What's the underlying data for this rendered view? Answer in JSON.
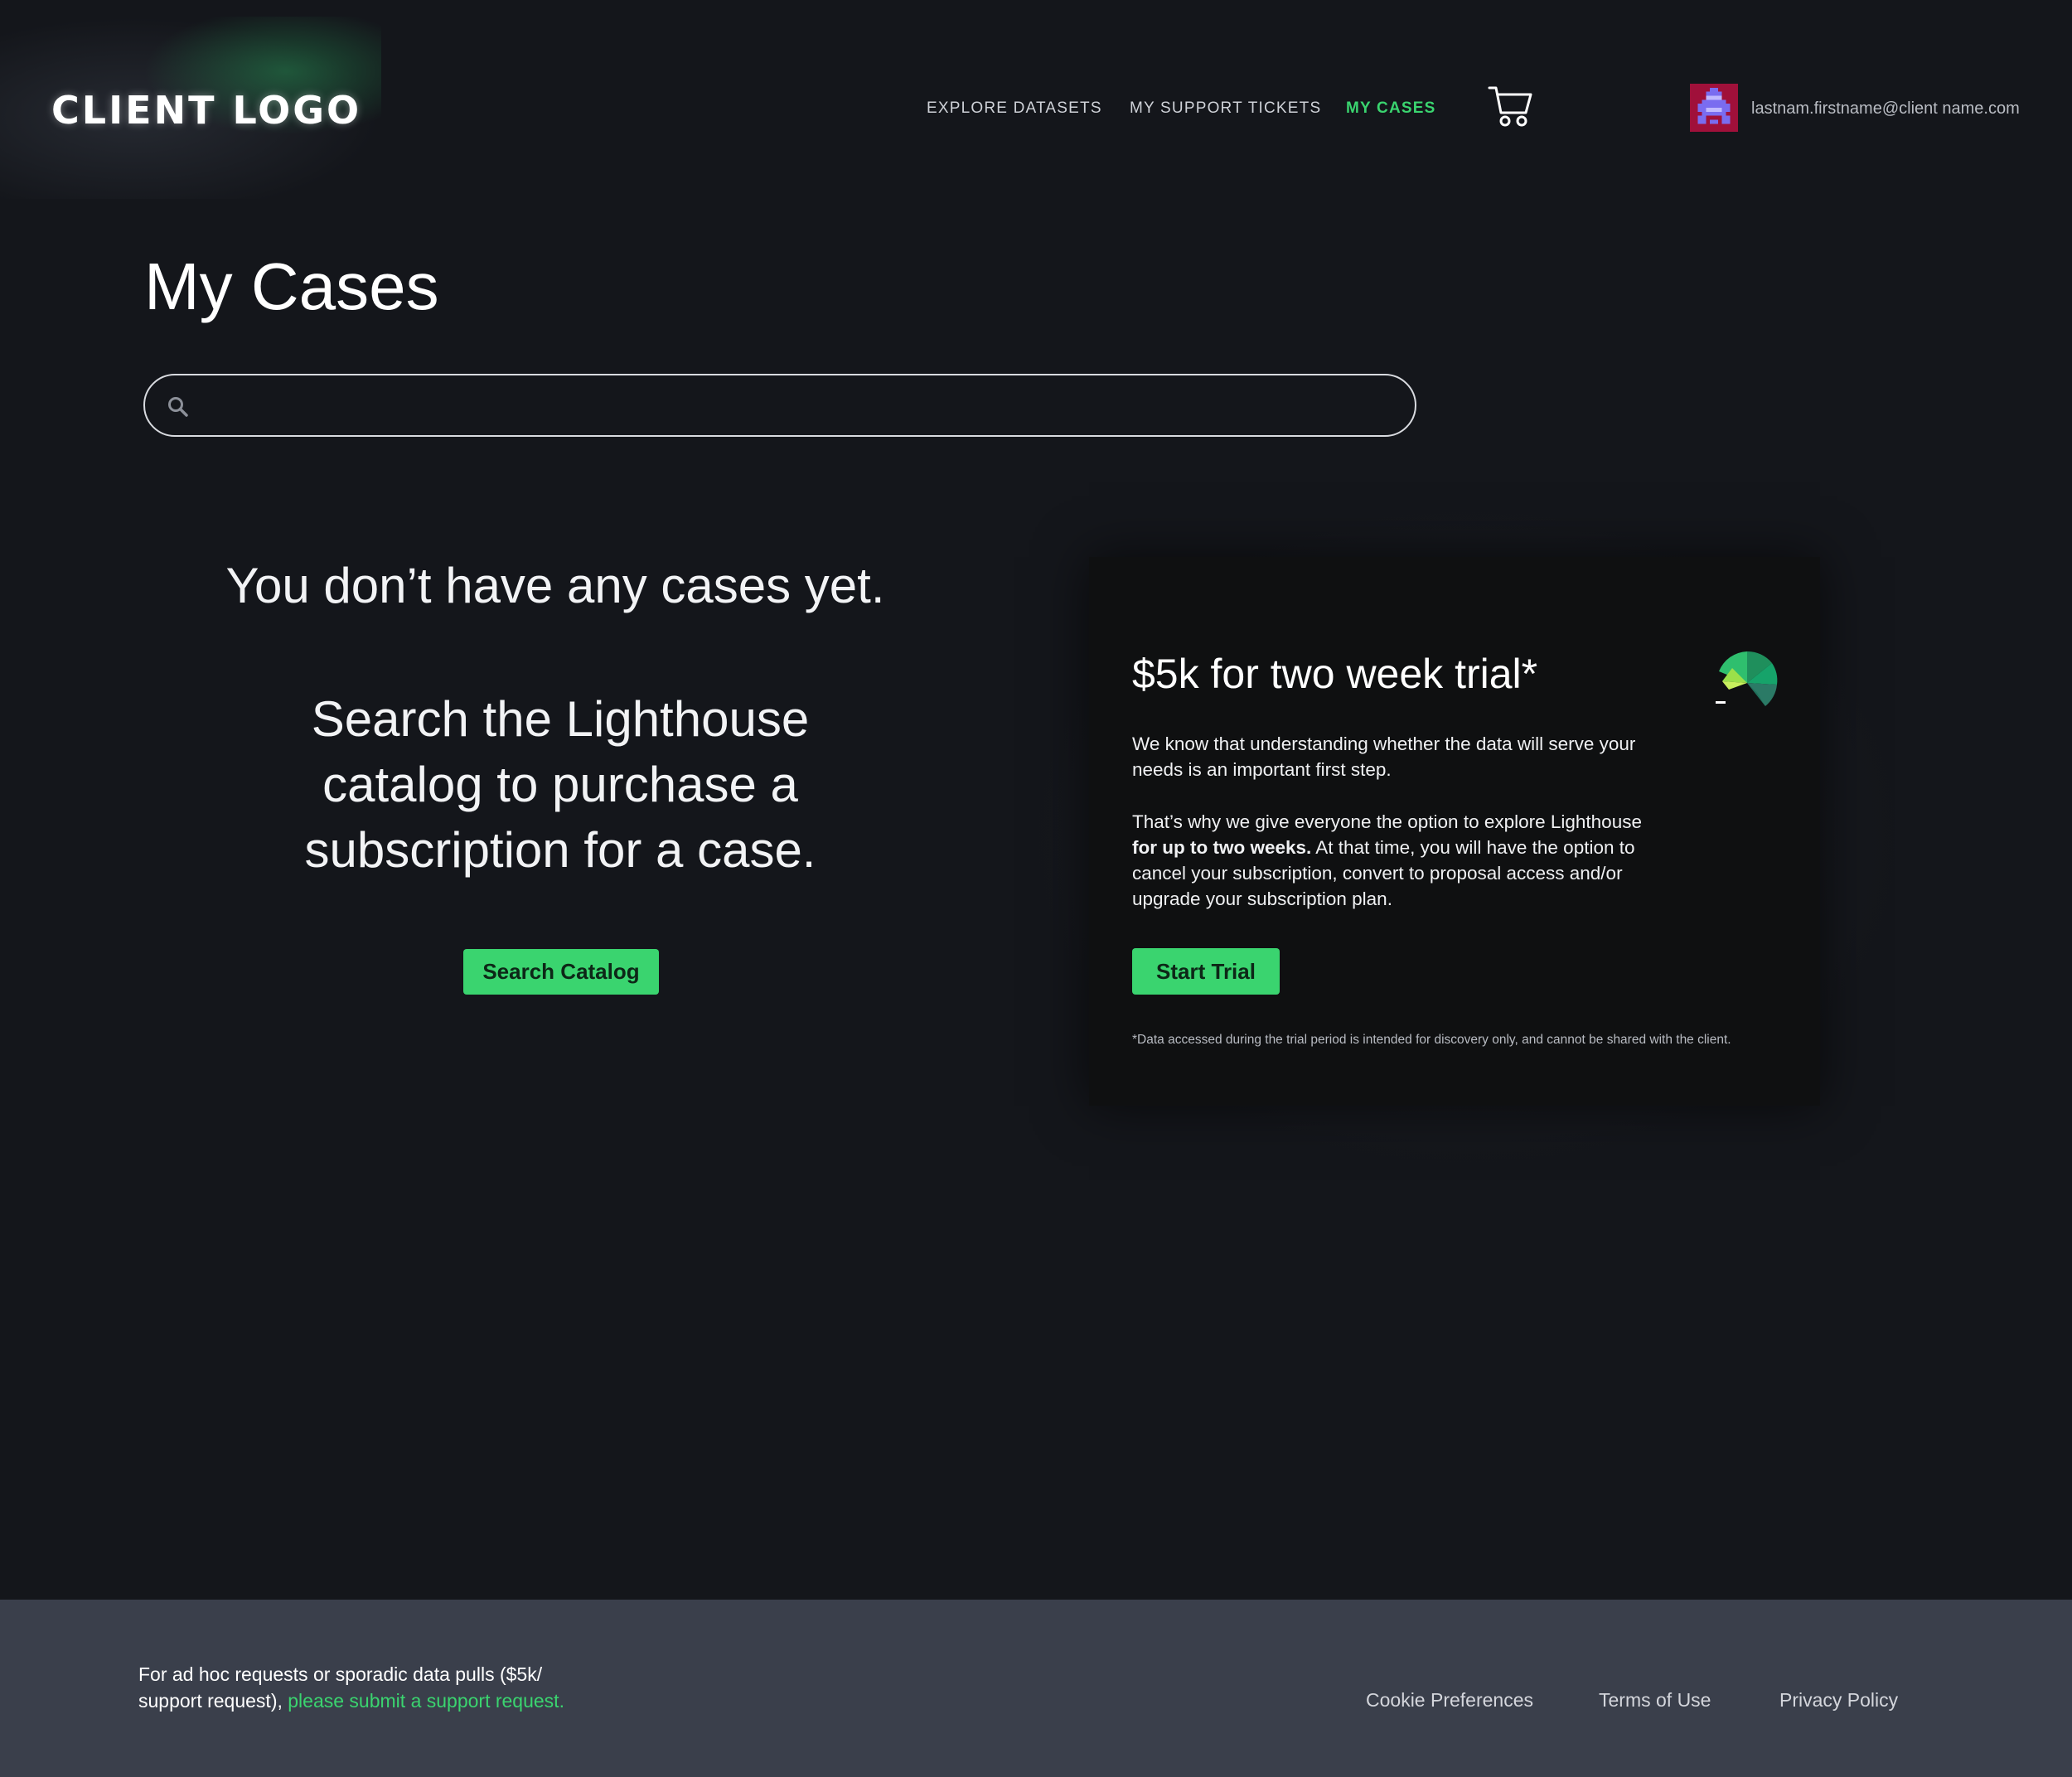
{
  "header": {
    "logo": "CLIENT LOGO",
    "nav": {
      "explore": "EXPLORE DATASETS",
      "tickets": "MY SUPPORT TICKETS",
      "cases": "MY CASES"
    },
    "user_email": "lastnam.firstname@client name.com"
  },
  "main": {
    "title": "My Cases",
    "search": {
      "placeholder": "",
      "value": ""
    },
    "empty_title": "You don’t have any cases yet.",
    "empty_sub": "Search the Lighthouse catalog to purchase a subscription for a case.",
    "search_catalog_label": "Search Catalog"
  },
  "trial_card": {
    "title": "$5k for two week trial*",
    "p1": "We know that understanding whether the data will serve your needs is an important first step.",
    "p2_before": "That’s why we give everyone the option to explore Lighthouse ",
    "p2_bold": "for up to two weeks.",
    "p2_after": " At that time, you will have the option to cancel your subscription, convert to proposal access and/or upgrade your subscription plan.",
    "button_label": "Start Trial",
    "footnote": "*Data accessed during the trial period is intended for discovery only, and cannot be shared with the client."
  },
  "footer": {
    "text": "For ad hoc requests or sporadic data  pulls ($5k/ support request), ",
    "link_text": "please submit a support request.",
    "cookie": "Cookie Preferences",
    "terms": "Terms of Use",
    "privacy": "Privacy Policy"
  },
  "colors": {
    "background": "#14161b",
    "accent_green": "#3ad46f",
    "card_bg": "#0f1011",
    "footer_bg": "#3a3f4b"
  },
  "icons": {
    "cart": "shopping-cart-icon",
    "search": "search-icon",
    "avatar": "pixel-avatar",
    "card_logo": "lighthouse-logo-icon"
  }
}
